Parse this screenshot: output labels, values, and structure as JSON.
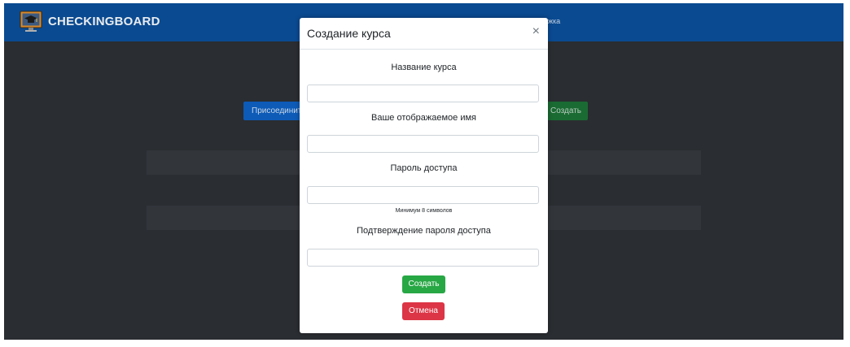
{
  "navbar": {
    "brand_name": "CHECKINGBOARD",
    "right_link_partial": "жка"
  },
  "background": {
    "join_button_label": "Присоединит",
    "create_button_label": "Создать"
  },
  "modal": {
    "title": "Создание курса",
    "close_symbol": "×",
    "course_name_label": "Название курса",
    "course_name_value": "",
    "display_name_label": "Ваше отображаемое имя",
    "display_name_value": "",
    "password_label": "Пароль доступа",
    "password_value": "",
    "password_hint": "Минимум 8 символов",
    "password_confirm_label": "Подтверждение пароля доступа",
    "password_confirm_value": "",
    "create_button_label": "Создать",
    "cancel_button_label": "Отмена"
  },
  "colors": {
    "navbar": "#0a4a91",
    "page_background": "#2a2d31",
    "create_green": "#28a745",
    "cancel_red": "#dc3545",
    "join_blue": "#0d5bb7"
  },
  "icons": {
    "brand_logo": "graduation-cap-monitor-icon",
    "close": "close-icon"
  }
}
